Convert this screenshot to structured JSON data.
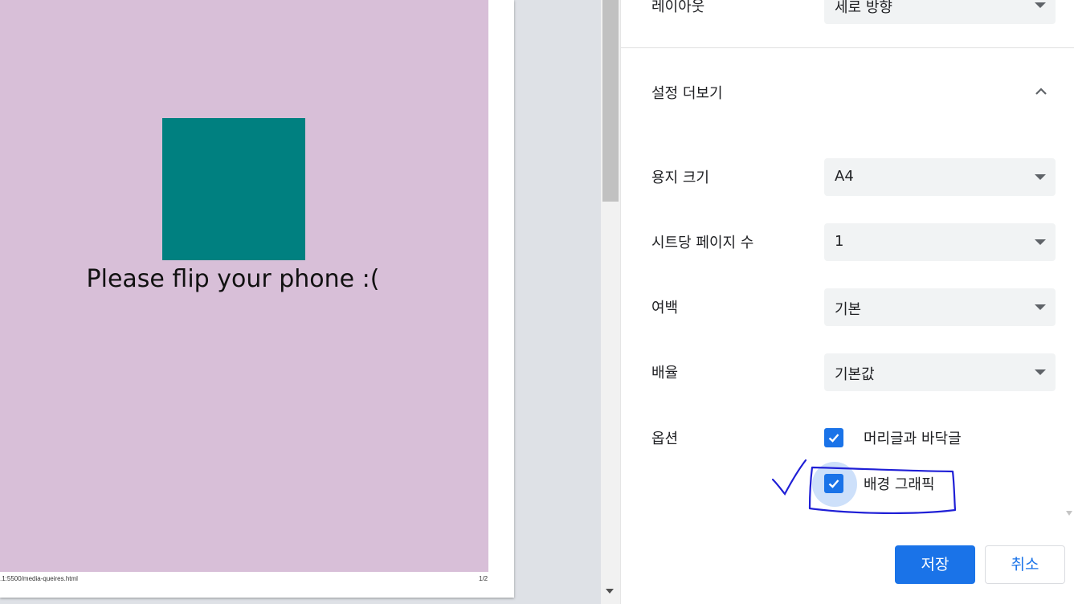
{
  "preview": {
    "message": "Please flip your phone :(",
    "footer_url": ".1:5500/media-queires.html",
    "page_number": "1/2",
    "page_bg_color": "#d8bfd8",
    "box_color": "#008080"
  },
  "settings": {
    "layout": {
      "label": "레이아웃",
      "value": "세로 방향"
    },
    "more_settings": {
      "label": "설정 더보기"
    },
    "paper_size": {
      "label": "용지 크기",
      "value": "A4"
    },
    "pages_per_sheet": {
      "label": "시트당 페이지 수",
      "value": "1"
    },
    "margins": {
      "label": "여백",
      "value": "기본"
    },
    "scale": {
      "label": "배율",
      "value": "기본값"
    },
    "options": {
      "label": "옵션",
      "headers_footers": {
        "label": "머리글과 바닥글",
        "checked": true
      },
      "background_graphics": {
        "label": "배경 그래픽",
        "checked": true
      }
    }
  },
  "actions": {
    "save": "저장",
    "cancel": "취소"
  },
  "colors": {
    "accent": "#1a73e8",
    "annotation": "#1f1fd6"
  }
}
